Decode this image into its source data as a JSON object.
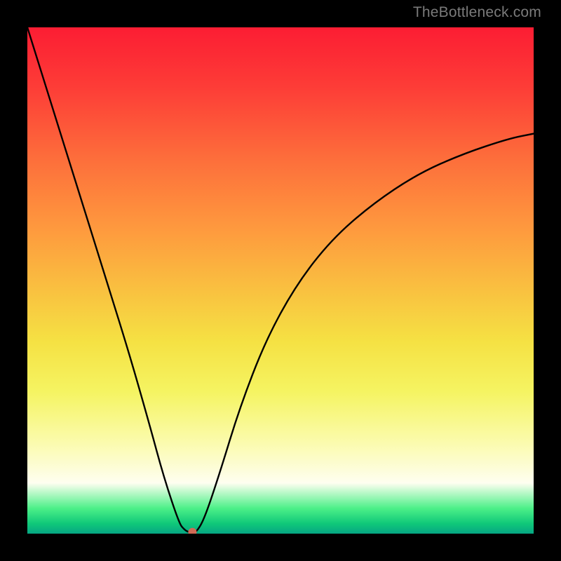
{
  "watermark": "TheBottleneck.com",
  "chart_data": {
    "type": "line",
    "title": "",
    "xlabel": "",
    "ylabel": "",
    "xlim": [
      0,
      100
    ],
    "ylim": [
      0,
      100
    ],
    "grid": false,
    "legend": false,
    "series": [
      {
        "name": "curve",
        "x": [
          0,
          5,
          10,
          15,
          20,
          24,
          27,
          30,
          31,
          31.8,
          32.6,
          33.4,
          35,
          38,
          42,
          47,
          53,
          60,
          68,
          77,
          86,
          95,
          100
        ],
        "y": [
          100,
          84,
          68,
          52,
          36,
          22,
          11,
          2,
          0.8,
          0.3,
          0.3,
          0.3,
          3,
          12,
          25,
          38,
          49,
          58,
          65,
          71,
          75,
          78,
          79
        ]
      }
    ],
    "marker": {
      "name": "bottleneck-point",
      "x": 32.6,
      "y": 0.3
    },
    "background_gradient": {
      "direction": "vertical",
      "stops": [
        {
          "pos": 0.0,
          "color": "#fc1d33"
        },
        {
          "pos": 0.26,
          "color": "#fd6e3b"
        },
        {
          "pos": 0.52,
          "color": "#f9c140"
        },
        {
          "pos": 0.72,
          "color": "#f5f462"
        },
        {
          "pos": 0.9,
          "color": "#fefef0"
        },
        {
          "pos": 0.96,
          "color": "#2de785"
        },
        {
          "pos": 1.0,
          "color": "#06a683"
        }
      ]
    }
  }
}
